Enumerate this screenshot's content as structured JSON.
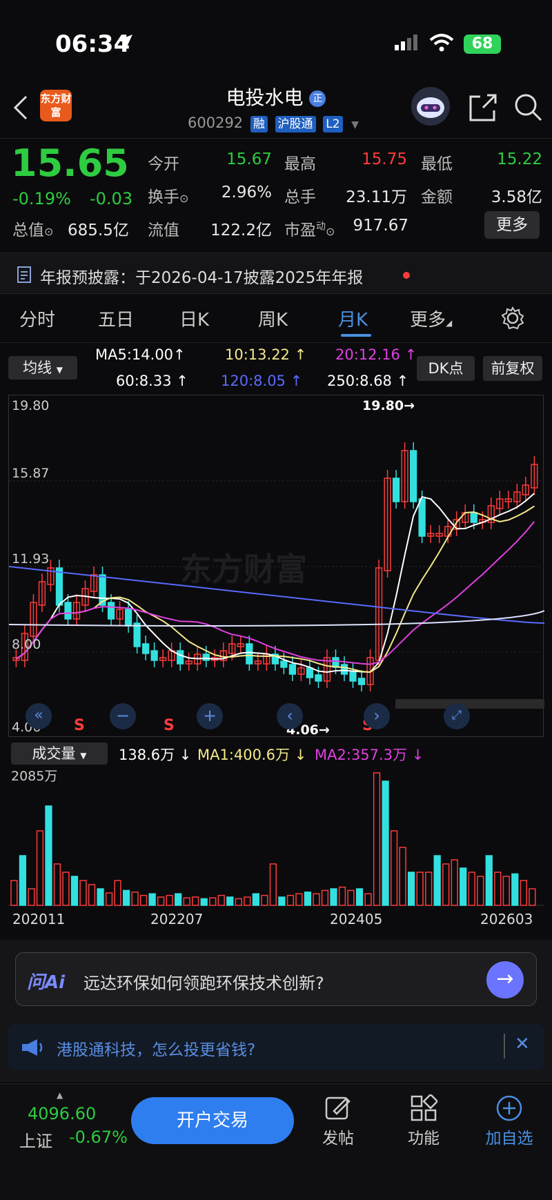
{
  "status": {
    "time": "06:34",
    "battery": "68"
  },
  "header": {
    "logo": "东方财富",
    "name": "电投水电",
    "name_badge": "正",
    "code": "600292",
    "tags": [
      "融",
      "沪股通",
      "L2"
    ]
  },
  "quote": {
    "price": "15.65",
    "change_pct": "-0.19%",
    "change": "-0.03",
    "total_value_label": "总值",
    "total_value": "685.5亿",
    "open_label": "今开",
    "open": "15.67",
    "high_label": "最高",
    "high": "15.75",
    "low_label": "最低",
    "low": "15.22",
    "turnover_label": "换手",
    "turnover": "2.96%",
    "volume_label": "总手",
    "volume": "23.11万",
    "amount_label": "金额",
    "amount": "3.58亿",
    "float_label": "流值",
    "float": "122.2亿",
    "pe_label": "市盈",
    "pe_sup": "动",
    "pe": "917.67",
    "more": "更多"
  },
  "notice": {
    "text": "年报预披露：于2026-04-17披露2025年年报"
  },
  "tabs": [
    "分时",
    "五日",
    "日K",
    "周K",
    "月K",
    "更多"
  ],
  "active_tab": "月K",
  "indicators": {
    "selector": "均线",
    "ma5": "MA5:14.00↑",
    "ma10": "10:13.22 ↑",
    "ma20": "20:12.16 ↑",
    "ma60": "60:8.33 ↑",
    "ma120": "120:8.05 ↑",
    "ma250": "250:8.68 ↑",
    "dk": "DK点",
    "fq": "前复权"
  },
  "chart": {
    "y_labels": [
      "19.80",
      "15.87",
      "11.93",
      "8.00",
      "4.06"
    ],
    "high_mark": "19.80→",
    "low_mark": "4.06→",
    "watermark": "东方财富",
    "signals": [
      "S",
      "S",
      "S"
    ]
  },
  "volume": {
    "selector": "成交量",
    "current": "138.6万 ↓",
    "ma1": "MA1:400.6万 ↓",
    "ma2": "MA2:357.3万 ↓",
    "max": "2085万",
    "dates": [
      "202011",
      "202207",
      "202405",
      "202603"
    ]
  },
  "ai": {
    "logo": "问Ai",
    "question": "远达环保如何领跑环保技术创新?"
  },
  "promo": {
    "text": "港股通科技，怎么投更省钱?"
  },
  "bottom": {
    "index_value": "4096.60",
    "index_name": "上证",
    "index_change": "-0.67%",
    "open_account": "开户交易",
    "post": "发帖",
    "functions": "功能",
    "add_watch": "加自选"
  },
  "colors": {
    "up": "#ff3b3b",
    "down": "#2ecc40",
    "accent": "#2f7ef0",
    "cyan_candle": "#33e0e0"
  }
}
